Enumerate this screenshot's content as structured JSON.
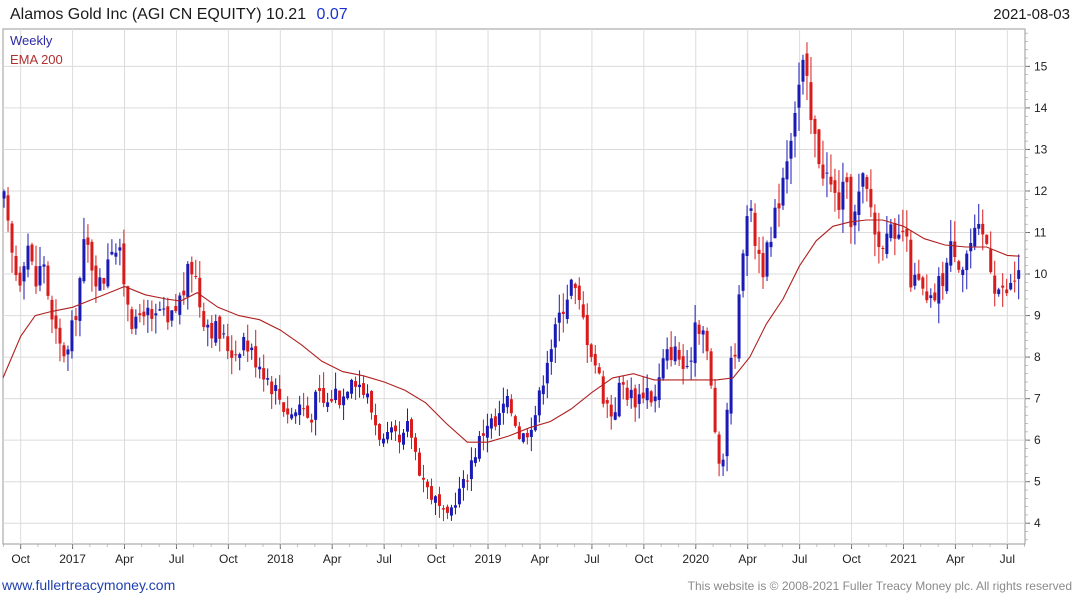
{
  "header": {
    "title": "Alamos Gold Inc (AGI CN EQUITY) 10.21",
    "change": "0.07",
    "date": "2021-08-03"
  },
  "legend": {
    "series_label": "Weekly",
    "ema_label": "EMA 200"
  },
  "footer": {
    "link": "www.fullertreacymoney.com",
    "copyright": "This website is © 2008-2021 Fuller Treacy Money plc. All rights reserved"
  },
  "colors": {
    "up": "#1a1ab4",
    "down": "#d81b1b",
    "ema": "#b02020",
    "grid": "#dcdcdc"
  },
  "chart_data": {
    "type": "candlestick",
    "interval": "weekly",
    "x_range": [
      2016.665,
      2021.585
    ],
    "ylim": [
      3.5,
      15.9
    ],
    "y_ticks": [
      4,
      5,
      6,
      7,
      8,
      9,
      10,
      11,
      12,
      13,
      14,
      15
    ],
    "x_ticks": [
      {
        "label": "Oct",
        "t": 2016.75
      },
      {
        "label": "2017",
        "t": 2017.0
      },
      {
        "label": "Apr",
        "t": 2017.25
      },
      {
        "label": "Jul",
        "t": 2017.5
      },
      {
        "label": "Oct",
        "t": 2017.75
      },
      {
        "label": "2018",
        "t": 2018.0
      },
      {
        "label": "Apr",
        "t": 2018.25
      },
      {
        "label": "Jul",
        "t": 2018.5
      },
      {
        "label": "Oct",
        "t": 2018.75
      },
      {
        "label": "2019",
        "t": 2019.0
      },
      {
        "label": "Apr",
        "t": 2019.25
      },
      {
        "label": "Jul",
        "t": 2019.5
      },
      {
        "label": "Oct",
        "t": 2019.75
      },
      {
        "label": "2020",
        "t": 2020.0
      },
      {
        "label": "Apr",
        "t": 2020.25
      },
      {
        "label": "Jul",
        "t": 2020.5
      },
      {
        "label": "Oct",
        "t": 2020.75
      },
      {
        "label": "2021",
        "t": 2021.0
      },
      {
        "label": "Apr",
        "t": 2021.25
      },
      {
        "label": "Jul",
        "t": 2021.5
      }
    ],
    "close_path": [
      [
        2016.67,
        11.7
      ],
      [
        2016.7,
        10.6
      ],
      [
        2016.74,
        9.8
      ],
      [
        2016.78,
        10.9
      ],
      [
        2016.82,
        9.7
      ],
      [
        2016.86,
        10.4
      ],
      [
        2016.9,
        8.8
      ],
      [
        2016.94,
        8.2
      ],
      [
        2016.98,
        8.1
      ],
      [
        2017.02,
        9.3
      ],
      [
        2017.06,
        10.8
      ],
      [
        2017.1,
        10.2
      ],
      [
        2017.14,
        9.6
      ],
      [
        2017.18,
        10.9
      ],
      [
        2017.22,
        10.5
      ],
      [
        2017.26,
        9.6
      ],
      [
        2017.3,
        8.6
      ],
      [
        2017.34,
        9.3
      ],
      [
        2017.38,
        8.7
      ],
      [
        2017.42,
        9.1
      ],
      [
        2017.46,
        8.7
      ],
      [
        2017.5,
        9.2
      ],
      [
        2017.54,
        9.7
      ],
      [
        2017.58,
        10.3
      ],
      [
        2017.62,
        9.1
      ],
      [
        2017.66,
        8.8
      ],
      [
        2017.7,
        8.6
      ],
      [
        2017.74,
        8.3
      ],
      [
        2017.78,
        8.1
      ],
      [
        2017.82,
        8.5
      ],
      [
        2017.86,
        8.1
      ],
      [
        2017.9,
        7.9
      ],
      [
        2017.94,
        7.5
      ],
      [
        2017.98,
        7.2
      ],
      [
        2018.02,
        6.8
      ],
      [
        2018.06,
        6.6
      ],
      [
        2018.1,
        6.9
      ],
      [
        2018.14,
        6.5
      ],
      [
        2018.18,
        7.1
      ],
      [
        2018.22,
        6.8
      ],
      [
        2018.26,
        7.2
      ],
      [
        2018.3,
        7.0
      ],
      [
        2018.34,
        7.7
      ],
      [
        2018.38,
        7.4
      ],
      [
        2018.42,
        7.0
      ],
      [
        2018.46,
        6.4
      ],
      [
        2018.5,
        5.9
      ],
      [
        2018.54,
        6.1
      ],
      [
        2018.58,
        5.8
      ],
      [
        2018.62,
        6.4
      ],
      [
        2018.66,
        5.5
      ],
      [
        2018.7,
        4.9
      ],
      [
        2018.74,
        4.6
      ],
      [
        2018.78,
        4.2
      ],
      [
        2018.8,
        4.0
      ],
      [
        2018.84,
        4.6
      ],
      [
        2018.88,
        4.9
      ],
      [
        2018.92,
        5.5
      ],
      [
        2018.96,
        6.0
      ],
      [
        2019.0,
        6.5
      ],
      [
        2019.04,
        6.3
      ],
      [
        2019.08,
        6.9
      ],
      [
        2019.12,
        6.7
      ],
      [
        2019.16,
        6.0
      ],
      [
        2019.2,
        6.4
      ],
      [
        2019.24,
        6.8
      ],
      [
        2019.28,
        8.0
      ],
      [
        2019.32,
        8.5
      ],
      [
        2019.36,
        9.3
      ],
      [
        2019.4,
        9.8
      ],
      [
        2019.44,
        9.2
      ],
      [
        2019.48,
        8.5
      ],
      [
        2019.52,
        7.8
      ],
      [
        2019.56,
        7.0
      ],
      [
        2019.6,
        6.6
      ],
      [
        2019.64,
        7.4
      ],
      [
        2019.68,
        7.1
      ],
      [
        2019.72,
        7.0
      ],
      [
        2019.76,
        7.3
      ],
      [
        2019.8,
        6.9
      ],
      [
        2019.84,
        7.8
      ],
      [
        2019.88,
        8.2
      ],
      [
        2019.92,
        8.0
      ],
      [
        2019.96,
        7.5
      ],
      [
        2020.0,
        9.0
      ],
      [
        2020.04,
        8.6
      ],
      [
        2020.08,
        7.0
      ],
      [
        2020.12,
        4.8
      ],
      [
        2020.16,
        7.5
      ],
      [
        2020.2,
        8.6
      ],
      [
        2020.24,
        11.8
      ],
      [
        2020.28,
        11.0
      ],
      [
        2020.32,
        10.2
      ],
      [
        2020.36,
        10.6
      ],
      [
        2020.4,
        11.9
      ],
      [
        2020.44,
        13.0
      ],
      [
        2020.48,
        14.2
      ],
      [
        2020.52,
        15.0
      ],
      [
        2020.56,
        13.4
      ],
      [
        2020.6,
        12.8
      ],
      [
        2020.64,
        12.2
      ],
      [
        2020.68,
        11.7
      ],
      [
        2020.72,
        12.0
      ],
      [
        2020.76,
        11.2
      ],
      [
        2020.8,
        12.2
      ],
      [
        2020.84,
        11.7
      ],
      [
        2020.88,
        10.6
      ],
      [
        2020.92,
        11.3
      ],
      [
        2020.96,
        10.5
      ],
      [
        2021.0,
        11.1
      ],
      [
        2021.04,
        9.8
      ],
      [
        2021.08,
        9.7
      ],
      [
        2021.12,
        9.1
      ],
      [
        2021.16,
        9.6
      ],
      [
        2021.2,
        10.1
      ],
      [
        2021.24,
        10.8
      ],
      [
        2021.28,
        10.2
      ],
      [
        2021.32,
        10.7
      ],
      [
        2021.36,
        10.9
      ],
      [
        2021.4,
        10.8
      ],
      [
        2021.44,
        9.8
      ],
      [
        2021.48,
        9.5
      ],
      [
        2021.52,
        9.7
      ],
      [
        2021.56,
        10.21
      ]
    ],
    "ema_path": [
      [
        2016.665,
        7.5
      ],
      [
        2016.75,
        8.5
      ],
      [
        2016.82,
        9.0
      ],
      [
        2016.9,
        9.1
      ],
      [
        2017.0,
        9.2
      ],
      [
        2017.1,
        9.4
      ],
      [
        2017.2,
        9.6
      ],
      [
        2017.25,
        9.7
      ],
      [
        2017.35,
        9.5
      ],
      [
        2017.45,
        9.4
      ],
      [
        2017.52,
        9.35
      ],
      [
        2017.6,
        9.55
      ],
      [
        2017.7,
        9.2
      ],
      [
        2017.8,
        9.0
      ],
      [
        2017.9,
        8.9
      ],
      [
        2018.0,
        8.65
      ],
      [
        2018.1,
        8.3
      ],
      [
        2018.2,
        7.9
      ],
      [
        2018.3,
        7.65
      ],
      [
        2018.4,
        7.55
      ],
      [
        2018.5,
        7.4
      ],
      [
        2018.6,
        7.2
      ],
      [
        2018.7,
        6.9
      ],
      [
        2018.8,
        6.4
      ],
      [
        2018.9,
        5.95
      ],
      [
        2019.0,
        5.95
      ],
      [
        2019.1,
        6.1
      ],
      [
        2019.2,
        6.3
      ],
      [
        2019.3,
        6.45
      ],
      [
        2019.4,
        6.75
      ],
      [
        2019.5,
        7.15
      ],
      [
        2019.6,
        7.5
      ],
      [
        2019.7,
        7.6
      ],
      [
        2019.8,
        7.45
      ],
      [
        2019.9,
        7.45
      ],
      [
        2020.0,
        7.45
      ],
      [
        2020.1,
        7.45
      ],
      [
        2020.18,
        7.5
      ],
      [
        2020.26,
        8.0
      ],
      [
        2020.34,
        8.8
      ],
      [
        2020.42,
        9.4
      ],
      [
        2020.5,
        10.2
      ],
      [
        2020.58,
        10.8
      ],
      [
        2020.66,
        11.15
      ],
      [
        2020.74,
        11.25
      ],
      [
        2020.82,
        11.3
      ],
      [
        2020.9,
        11.3
      ],
      [
        2021.0,
        11.15
      ],
      [
        2021.1,
        10.85
      ],
      [
        2021.2,
        10.7
      ],
      [
        2021.3,
        10.65
      ],
      [
        2021.4,
        10.65
      ],
      [
        2021.5,
        10.45
      ],
      [
        2021.56,
        10.43
      ]
    ]
  }
}
